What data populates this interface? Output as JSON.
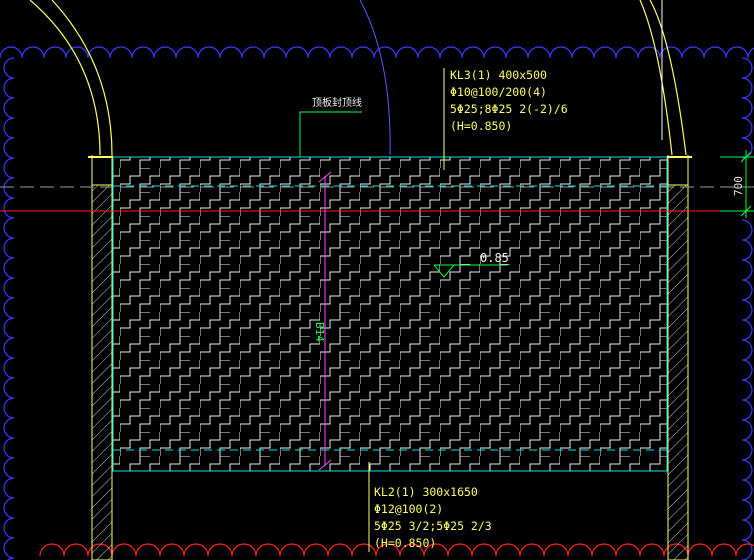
{
  "drawing": {
    "label_top_slab": "顶板封顶线",
    "beam_top": {
      "name": "KL3(1) 400x500",
      "stirrup": "Φ10@100/200(4)",
      "rebar": "5Φ25;8Φ25 2(-2)/6",
      "elevation": "(H=0.850)"
    },
    "beam_bottom": {
      "name": "KL2(1) 300x1650",
      "stirrup": "Φ12@100(2)",
      "rebar": "5Φ25 3/2;5Φ25 2/3",
      "elevation": "(H=0.850)"
    },
    "elevation_marker": "0.85",
    "span_label": "B14",
    "dimension_right": "700"
  },
  "colors": {
    "background": "#000000",
    "cloud": "#3a3aff",
    "wall_outline": "#ffff66",
    "slab_line": "#00e5e5",
    "hatch": "#f0f0f0",
    "dim": "#00ff44",
    "magenta": "#ff4cff",
    "red": "#ff2020",
    "leader": "#ffff66",
    "grey_dash": "#9a9a9a",
    "text": "#ffff66"
  }
}
